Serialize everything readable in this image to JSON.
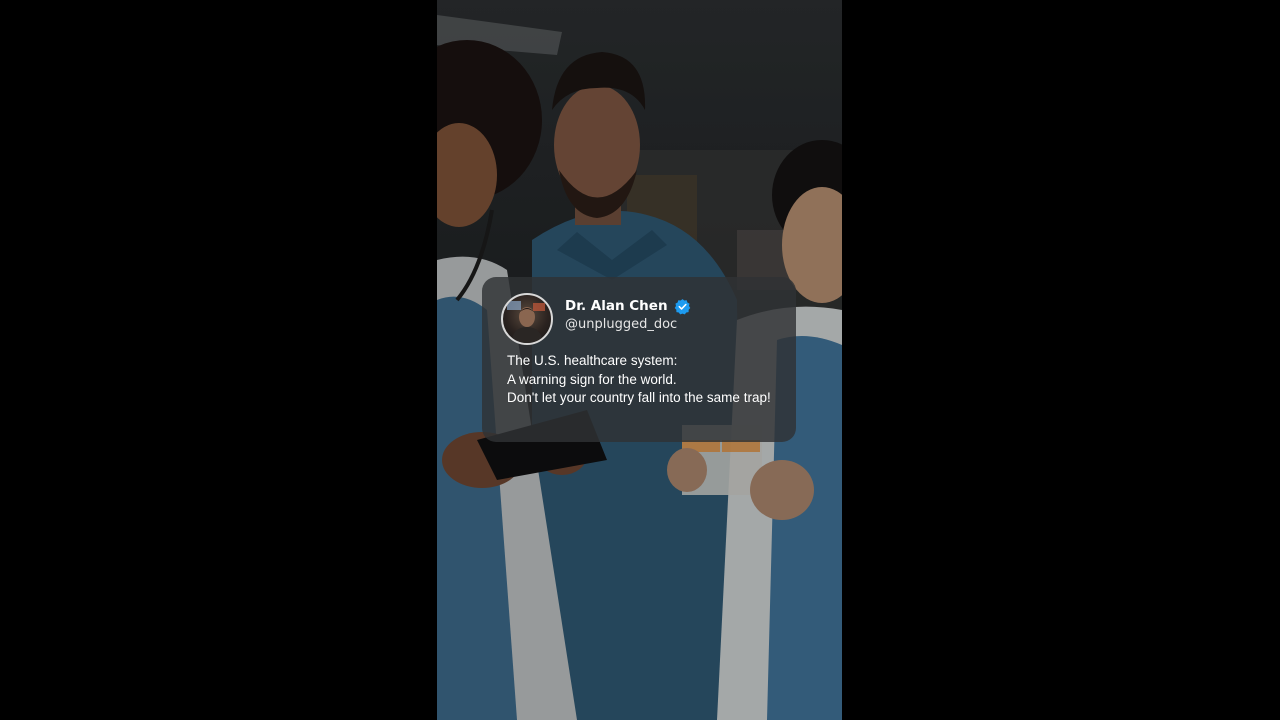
{
  "post": {
    "author_name": "Dr. Alan Chen",
    "author_handle": "@unplugged_doc",
    "verified": true,
    "lines": [
      "The U.S. healthcare system:",
      "A warning sign for the world.",
      "Don't let your country fall into the same trap!"
    ]
  },
  "icons": {
    "verified": "verified-badge-icon",
    "avatar": "profile-photo"
  },
  "colors": {
    "verified_badge": "#1d9bf0",
    "card_background": "#303234",
    "scrubs": "#3d6f8f"
  }
}
